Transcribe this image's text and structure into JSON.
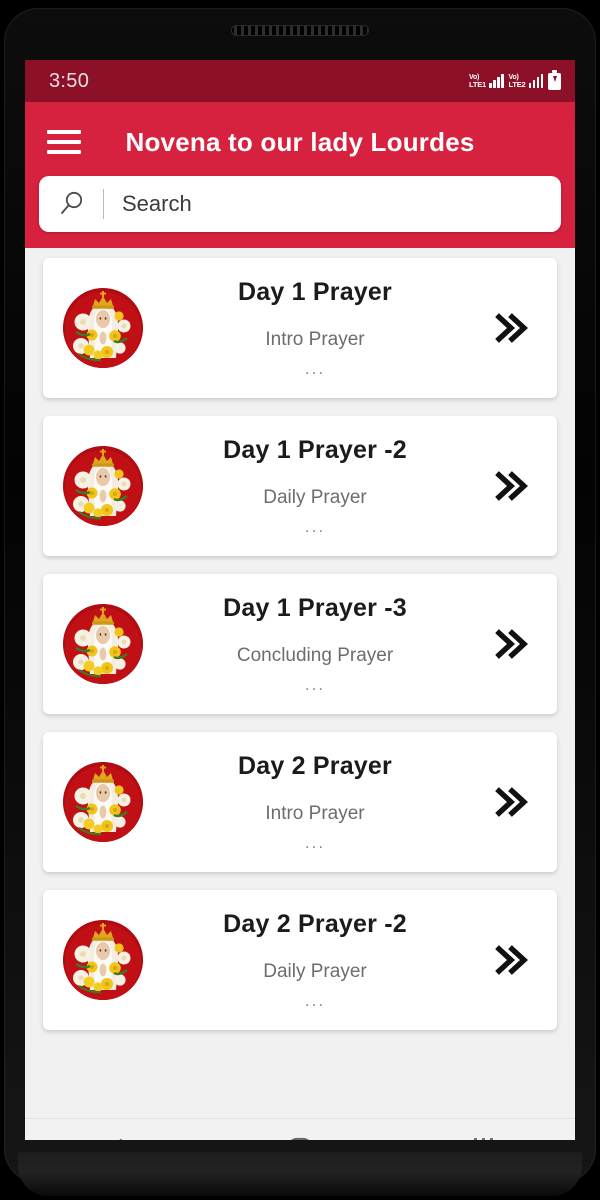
{
  "status_bar": {
    "clock": "3:50",
    "sim1_label_top": "Vo)",
    "sim1_label_bottom": "LTE1",
    "sim2_label_top": "Vo)",
    "sim2_label_bottom": "LTE2",
    "signal_icon": "signal-bars-icon",
    "battery_icon": "battery-charging-icon",
    "background_color": "#8d1029"
  },
  "app_bar": {
    "menu_icon": "hamburger-menu-icon",
    "title": "Novena to our lady Lourdes",
    "background_color": "#d6213f",
    "title_color": "#ffffff"
  },
  "search": {
    "icon": "magnifier-icon",
    "placeholder": "Search",
    "value": ""
  },
  "list": {
    "thumbnail_icon": "our-lady-of-lourdes-image",
    "chevron_icon": "double-chevron-right-icon",
    "ellipsis": "...",
    "items": [
      {
        "title": "Day 1 Prayer",
        "subtitle": "Intro Prayer"
      },
      {
        "title": "Day 1 Prayer -2",
        "subtitle": "Daily Prayer"
      },
      {
        "title": "Day 1 Prayer -3",
        "subtitle": "Concluding Prayer"
      },
      {
        "title": "Day 2 Prayer",
        "subtitle": "Intro Prayer"
      },
      {
        "title": "Day 2 Prayer -2",
        "subtitle": "Daily Prayer"
      }
    ]
  },
  "nav_bar": {
    "back_icon": "back-chevron-icon",
    "home_icon": "home-squircle-icon",
    "recents_icon": "recents-bars-icon",
    "background_color": "#f2f2f2"
  }
}
